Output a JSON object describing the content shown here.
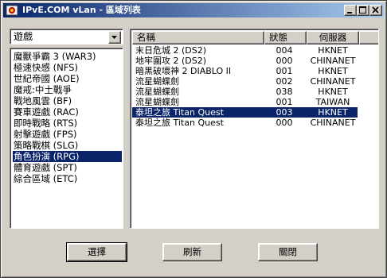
{
  "window": {
    "title": "IPvE.COM vLan - 區域列表",
    "icon": "ipve-app-icon"
  },
  "category_select": {
    "value": "遊戲"
  },
  "genres": [
    {
      "label": "魔獸爭霸 3 (WAR3)"
    },
    {
      "label": "極速快感 (NFS)"
    },
    {
      "label": "世紀帝國 (AOE)"
    },
    {
      "label": "魔戒:中土戰爭"
    },
    {
      "label": "戰地風雲 (BF)"
    },
    {
      "label": "賽車遊戲 (RAC)"
    },
    {
      "label": "即時戰略 (RTS)"
    },
    {
      "label": "射擊遊戲 (FPS)"
    },
    {
      "label": "策略戰棋 (SLG)"
    },
    {
      "label": "角色扮演 (RPG)",
      "selected": true
    },
    {
      "label": "體育遊戲 (SPT)"
    },
    {
      "label": "綜合區域 (ETC)"
    }
  ],
  "table": {
    "columns": [
      "名稱",
      "狀態",
      "伺服器"
    ],
    "rows": [
      {
        "name": "末日危城 2 (DS2)",
        "status": "004",
        "server": "HKNET"
      },
      {
        "name": "地牢圍攻 2 (DS2)",
        "status": "000",
        "server": "CHINANET"
      },
      {
        "name": "暗黑破壞神 2 DIABLO II",
        "status": "001",
        "server": "HKNET"
      },
      {
        "name": "流星蝴蝶劍",
        "status": "002",
        "server": "CHINANET"
      },
      {
        "name": "流星蝴蝶劍",
        "status": "038",
        "server": "HKNET"
      },
      {
        "name": "流星蝴蝶劍",
        "status": "001",
        "server": "TAIWAN"
      },
      {
        "name": "泰坦之旅 Titan Quest",
        "status": "003",
        "server": "HKNET",
        "selected": true
      },
      {
        "name": "泰坦之旅 Titan Quest",
        "status": "000",
        "server": "CHINANET"
      }
    ]
  },
  "buttons": {
    "select": "選擇",
    "refresh": "刷新",
    "close": "關閉"
  },
  "colors": {
    "selection": "#0a246a",
    "face": "#d4d0c8"
  }
}
